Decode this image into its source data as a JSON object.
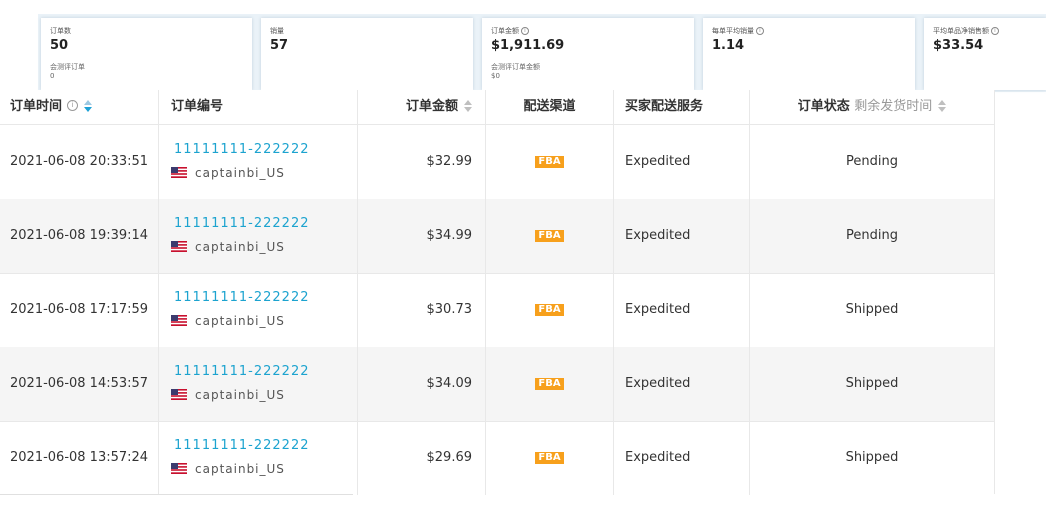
{
  "stats": [
    {
      "label": "订单数",
      "value": "50",
      "sub_label": "会测评订单",
      "sub_value": "0",
      "info": false
    },
    {
      "label": "销量",
      "value": "57",
      "sub_label": "",
      "sub_value": "",
      "info": false
    },
    {
      "label": "订单金额",
      "value": "$1,911.69",
      "sub_label": "会测评订单金额",
      "sub_value": "$0",
      "info": true
    },
    {
      "label": "每单平均销量",
      "value": "1.14",
      "sub_label": "",
      "sub_value": "",
      "info": true
    },
    {
      "label": "平均单品净销售额",
      "value": "$33.54",
      "sub_label": "",
      "sub_value": "",
      "info": true
    }
  ],
  "table": {
    "headers": {
      "time": "订单时间",
      "order_no": "订单编号",
      "amount": "订单金额",
      "channel": "配送渠道",
      "service": "买家配送服务",
      "status": "订单状态",
      "status_extra": "剩余发货时间"
    },
    "rows": [
      {
        "time": "2021-06-08 20:33:51",
        "order_no": "11111111-222222",
        "store": "captainbi_US",
        "amount": "$32.99",
        "channel": "FBA",
        "service": "Expedited",
        "status": "Pending"
      },
      {
        "time": "2021-06-08 19:39:14",
        "order_no": "11111111-222222",
        "store": "captainbi_US",
        "amount": "$34.99",
        "channel": "FBA",
        "service": "Expedited",
        "status": "Pending"
      },
      {
        "time": "2021-06-08 17:17:59",
        "order_no": "11111111-222222",
        "store": "captainbi_US",
        "amount": "$30.73",
        "channel": "FBA",
        "service": "Expedited",
        "status": "Shipped"
      },
      {
        "time": "2021-06-08 14:53:57",
        "order_no": "11111111-222222",
        "store": "captainbi_US",
        "amount": "$34.09",
        "channel": "FBA",
        "service": "Expedited",
        "status": "Shipped"
      },
      {
        "time": "2021-06-08 13:57:24",
        "order_no": "11111111-222222",
        "store": "captainbi_US",
        "amount": "$29.69",
        "channel": "FBA",
        "service": "Expedited",
        "status": "Shipped"
      }
    ]
  },
  "icons": {
    "info": "info-icon",
    "sort": "sort-icon",
    "flag": "us-flag-icon"
  },
  "colors": {
    "link": "#1ca3cf",
    "fba_badge": "#f7a01c",
    "alt_row": "#f5f5f5"
  }
}
